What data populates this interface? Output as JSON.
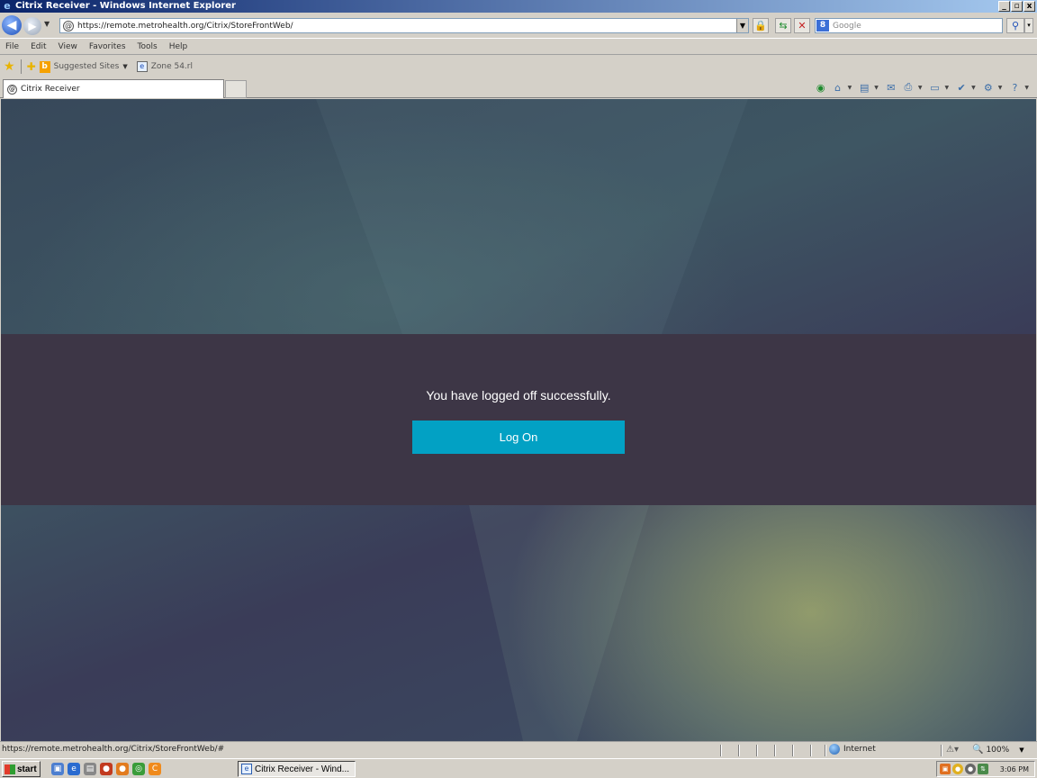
{
  "window": {
    "title": "Citrix Receiver - Windows Internet Explorer",
    "min_glyph": "_",
    "max_glyph": "▫",
    "close_glyph": "x"
  },
  "address": {
    "url": "https://remote.metrohealth.org/Citrix/StoreFrontWeb/",
    "search_placeholder": "Google"
  },
  "menu": [
    "File",
    "Edit",
    "View",
    "Favorites",
    "Tools",
    "Help"
  ],
  "favorites": {
    "suggested_sites": "Suggested Sites",
    "zone_link": "Zone 54.rl"
  },
  "tabs": [
    {
      "label": "Citrix Receiver"
    }
  ],
  "page": {
    "message": "You have logged off successfully.",
    "logon_label": "Log On"
  },
  "status": {
    "url": "https://remote.metrohealth.org/Citrix/StoreFrontWeb/#",
    "zone": "Internet",
    "zoom": "100%"
  },
  "taskbar": {
    "start_label": "start",
    "task_label": "Citrix Receiver - Wind...",
    "clock": "3:06 PM"
  },
  "colors": {
    "logon_button": "#02a1c4",
    "band": "#3d3646"
  },
  "icons": {
    "back": "back-arrow-icon",
    "forward": "forward-arrow-icon",
    "lock": "lock-icon",
    "refresh": "refresh-icon",
    "stop": "stop-icon",
    "search": "search-icon",
    "home": "home-icon",
    "feeds": "rss-icon",
    "mail": "mail-icon",
    "print": "print-icon",
    "page": "page-icon",
    "safety": "safety-icon",
    "tools": "gear-icon",
    "help": "help-icon"
  }
}
